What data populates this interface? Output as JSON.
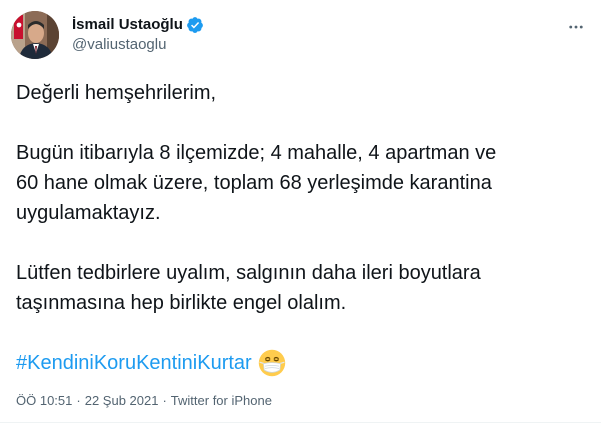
{
  "author": {
    "display_name": "İsmail Ustaoğlu",
    "handle": "@valiustaoglu",
    "verified_icon": "verified-badge-icon",
    "verified_color": "#1d9bf0"
  },
  "tweet": {
    "paragraphs": [
      "Değerli hemşehrilerim,",
      "Bugün itibarıyla 8 ilçemizde; 4 mahalle, 4 apartman ve\n60 hane olmak üzere, toplam 68 yerleşimde karantina\nuygulamaktayız.",
      "Lütfen tedbirlere uyalım, salgının daha ileri boyutlara\ntaşınmasına hep birlikte engel olalım."
    ],
    "hashtag": "#KendiniKoruKentiniKurtar",
    "emoji": "face-with-medical-mask-icon",
    "hashtag_color": "#1d9bf0"
  },
  "meta": {
    "time": "ÖÖ 10:51",
    "separator": "·",
    "date": "22 Şub 2021",
    "separator2": "·",
    "source": "Twitter for iPhone"
  },
  "more_icon": "more-options-icon"
}
